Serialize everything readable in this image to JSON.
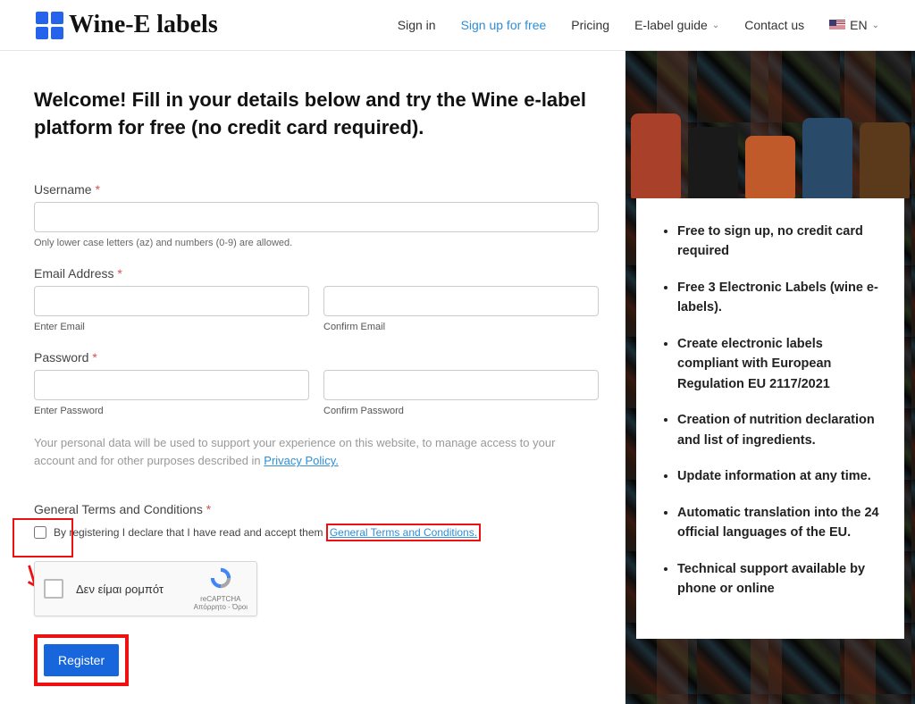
{
  "header": {
    "logo_text": "Wine-E labels",
    "nav": {
      "signin": "Sign in",
      "signup": "Sign up for free",
      "pricing": "Pricing",
      "guide": "E-label guide",
      "contact": "Contact us",
      "lang": "EN"
    }
  },
  "main": {
    "welcome": "Welcome! Fill in your details below and try the Wine e-label platform for free (no credit card required).",
    "username": {
      "label": "Username",
      "hint": "Only lower case letters (az) and numbers (0-9) are allowed."
    },
    "email": {
      "label": "Email Address",
      "enter": "Enter Email",
      "confirm": "Confirm Email"
    },
    "password": {
      "label": "Password",
      "enter": "Enter Password",
      "confirm": "Confirm Password"
    },
    "privacy_text": "Your personal data will be used to support your experience on this website, to manage access to your account and for other purposes described in ",
    "privacy_link": "Privacy Policy.",
    "terms": {
      "label": "General Terms and Conditions",
      "text": "By registering I declare that I have read and accept them ",
      "link": "General Terms and Conditions."
    },
    "captcha": {
      "text": "Δεν είμαι ρομπότ",
      "brand": "reCAPTCHA",
      "sub": "Απόρρητο - Όροι"
    },
    "register": "Register"
  },
  "sidebar": {
    "items": [
      "Free to sign up, no credit card required",
      "Free 3 Electronic Labels (wine e-labels).",
      "Create electronic labels compliant with European Regulation EU 2117/2021",
      "Creation of nutrition declaration and list of ingredients.",
      "Update information at any time.",
      "Automatic translation into the 24 official languages of the EU.",
      "Technical support available by phone or online"
    ]
  }
}
